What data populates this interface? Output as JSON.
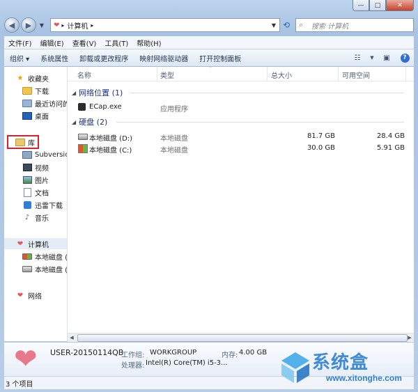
{
  "window": {
    "caption": {
      "min": "—",
      "max": "□",
      "close": "✕"
    }
  },
  "address": {
    "crumb": "计算机",
    "search_placeholder": "搜索 计算机"
  },
  "menu": [
    "文件(F)",
    "编辑(E)",
    "查看(V)",
    "工具(T)",
    "帮助(H)"
  ],
  "commands": [
    "组织 ▾",
    "系统属性",
    "卸载或更改程序",
    "映射网络驱动器",
    "打开控制面板"
  ],
  "nav": {
    "favorites": "收藏夹",
    "downloads": "下载",
    "recent": "最近访问的",
    "desktop": "桌面",
    "libraries": "库",
    "subversion": "Subversion",
    "videos": "视频",
    "pictures": "图片",
    "documents": "文档",
    "thunder": "迅雷下载",
    "music": "音乐",
    "computer": "计算机",
    "disk_c": "本地磁盘 (C",
    "disk_d": "本地磁盘 (D",
    "network": "网络"
  },
  "columns": {
    "name": "名称",
    "type": "类型",
    "total": "总大小",
    "free": "可用空间"
  },
  "groups": {
    "network_location": "网络位置 (1)",
    "hard_disk": "硬盘 (2)"
  },
  "rows": {
    "ecap": {
      "name": "ECap.exe",
      "type": "应用程序"
    },
    "disk_d": {
      "name": "本地磁盘 (D:)",
      "type": "本地磁盘",
      "total": "81.7 GB",
      "free": "28.4 GB"
    },
    "disk_c": {
      "name": "本地磁盘 (C:)",
      "type": "本地磁盘",
      "total": "30.0 GB",
      "free": "5.91 GB"
    }
  },
  "details": {
    "computer_name": "USER-20150114QB",
    "workgroup_label": "工作组:",
    "workgroup": "WORKGROUP",
    "memory_label": "内存:",
    "memory": "4.00 GB",
    "processor_label": "处理器:",
    "processor": "Intel(R) Core(TM) i5-3..."
  },
  "status": {
    "count": "3 个项目"
  },
  "watermark": {
    "brand": "系统盒",
    "url": "www.xitonghe.com"
  },
  "colors": {
    "highlight_box": "#d7212c",
    "group_header": "#1e3287",
    "watermark": "#2d7fd4"
  }
}
